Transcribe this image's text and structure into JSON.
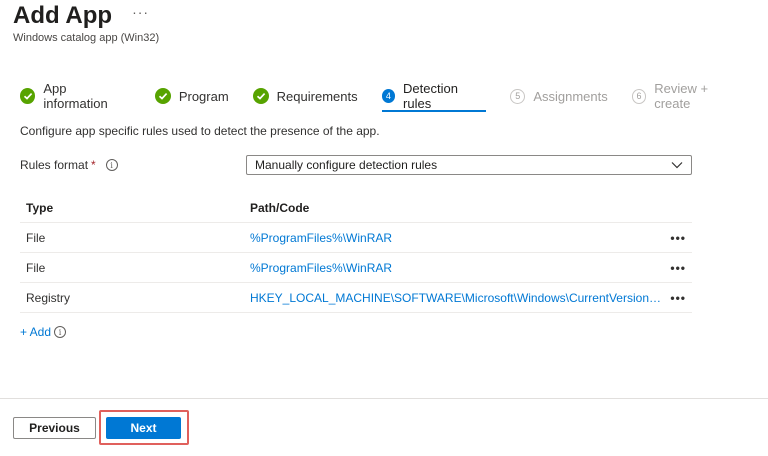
{
  "header": {
    "title": "Add App",
    "more": "···",
    "subtitle": "Windows catalog app (Win32)"
  },
  "wizard": {
    "steps": [
      {
        "label": "App information",
        "state": "completed",
        "icon": "check-icon"
      },
      {
        "label": "Program",
        "state": "completed",
        "icon": "check-icon"
      },
      {
        "label": "Requirements",
        "state": "completed",
        "icon": "check-icon"
      },
      {
        "label": "Detection rules",
        "state": "active",
        "number": "4"
      },
      {
        "label": "Assignments",
        "state": "disabled",
        "number": "5"
      },
      {
        "label": "Review + create",
        "state": "disabled",
        "number": "6"
      }
    ]
  },
  "description": "Configure app specific rules used to detect the presence of the app.",
  "rules_format": {
    "label": "Rules format",
    "required_mark": "*",
    "info": "i",
    "value": "Manually configure detection rules"
  },
  "table": {
    "headers": {
      "type": "Type",
      "path": "Path/Code"
    },
    "rows": [
      {
        "type": "File",
        "path": "%ProgramFiles%\\WinRAR",
        "more": "•••"
      },
      {
        "type": "File",
        "path": "%ProgramFiles%\\WinRAR",
        "more": "•••"
      },
      {
        "type": "Registry",
        "path": "HKEY_LOCAL_MACHINE\\SOFTWARE\\Microsoft\\Windows\\CurrentVersion\\Uninstall\\WinRAR archiver",
        "more": "•••"
      }
    ]
  },
  "add": {
    "label": "+ Add",
    "info": "i"
  },
  "footer": {
    "previous": "Previous",
    "next": "Next"
  },
  "colors": {
    "accent": "#0078d4",
    "success": "#57a300",
    "highlight": "#e0605c"
  }
}
